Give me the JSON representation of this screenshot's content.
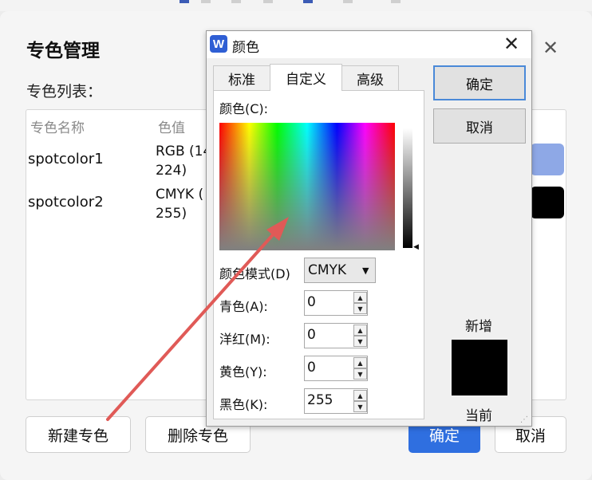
{
  "spot_manager": {
    "title": "专色管理",
    "list_label": "专色列表：",
    "columns": {
      "name": "专色名称",
      "value": "色值"
    },
    "rows": [
      {
        "name": "spotcolor1",
        "value_line1": "RGB (14",
        "value_line2": "224)",
        "swatch_color": "#8ea8e6"
      },
      {
        "name": "spotcolor2",
        "value_line1": "CMYK (",
        "value_line2": "255)",
        "swatch_color": "#000000"
      }
    ],
    "buttons": {
      "new": "新建专色",
      "delete": "删除专色",
      "ok": "确定",
      "cancel": "取消"
    }
  },
  "color_dialog": {
    "title": "颜色",
    "logo_letter": "W",
    "tabs": [
      {
        "label": "标准",
        "active": false
      },
      {
        "label": "自定义",
        "active": true
      },
      {
        "label": "高级",
        "active": false
      }
    ],
    "colors_label": "颜色(C):",
    "mode_label": "颜色模式(D)",
    "mode_value": "CMYK",
    "fields": [
      {
        "label": "青色(A):",
        "value": "0"
      },
      {
        "label": "洋红(M):",
        "value": "0"
      },
      {
        "label": "黄色(Y):",
        "value": "0"
      },
      {
        "label": "黑色(K):",
        "value": "255"
      }
    ],
    "ok_label": "确定",
    "cancel_label": "取消",
    "new_label": "新增",
    "current_label": "当前",
    "new_color": "#000000"
  },
  "colors": {
    "accent": "#2f6fe0",
    "annotation": "#e05a57"
  }
}
